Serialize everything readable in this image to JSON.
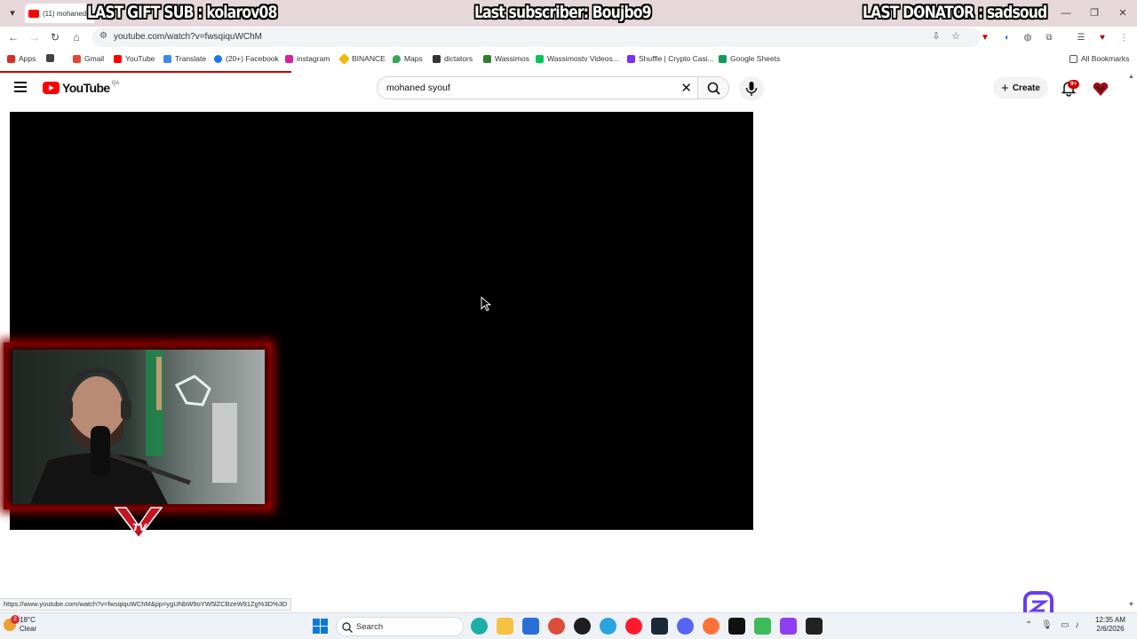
{
  "browser": {
    "tab_title": "(11) mohaned",
    "url": "youtube.com/watch?v=fwsqiquWChM",
    "status_url": "https://www.youtube.com/watch?v=fwsqiquWChM&pp=ygUNbW9oYW5lZCBzeW91Zg%3D%3D",
    "bookmarks": [
      {
        "label": "Apps",
        "color": "#1a73e8"
      },
      {
        "label": "",
        "color": "#444444"
      },
      {
        "label": "Gmail",
        "color": "#ea4335"
      },
      {
        "label": "YouTube",
        "color": "#ff0000"
      },
      {
        "label": "Translate",
        "color": "#4285f4"
      },
      {
        "label": "(20+) Facebook",
        "color": "#1877f2"
      },
      {
        "label": "instagram",
        "color": "#d6249f"
      },
      {
        "label": "BINANCE",
        "color": "#f0b90b"
      },
      {
        "label": "Maps",
        "color": "#34a853"
      },
      {
        "label": "dictators",
        "color": "#333333"
      },
      {
        "label": "Wassimos",
        "color": "#2e7d32"
      },
      {
        "label": "Wassimostv Videos...",
        "color": "#00c853"
      },
      {
        "label": "Shuffle | Crypto Casi...",
        "color": "#7b2ff7"
      },
      {
        "label": "Google Sheets",
        "color": "#0f9d58"
      }
    ],
    "all_bookmarks": "All Bookmarks"
  },
  "overlay": {
    "gift": "LAST GIFT SUB : kolarov08",
    "subscriber": "Last subscriber: Boujbo9",
    "donator": "LAST DONATOR : sadsoud"
  },
  "youtube": {
    "logo_word": "YouTube",
    "country_code": "QA",
    "search_query": "mohaned syouf",
    "create_label": "Create",
    "notif_badge": "9+"
  },
  "taskbar": {
    "temperature": "18°C",
    "condition": "Clear",
    "weather_badge": "2",
    "search_label": "Search",
    "time": "12:35 AM",
    "date": "2/6/2026"
  },
  "colors": {
    "accent_red": "#cc0000",
    "webcam_glow": "#8a0000",
    "player_bg": "#000000"
  }
}
